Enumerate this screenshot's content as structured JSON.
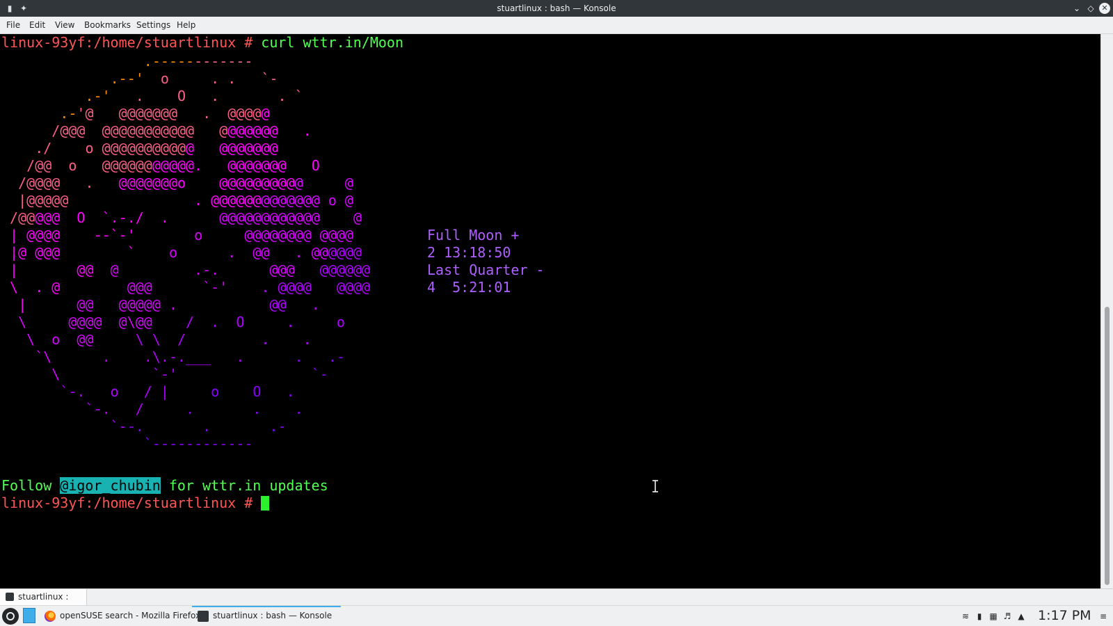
{
  "window": {
    "title": "stuartlinux : bash — Konsole"
  },
  "menubar": {
    "items": [
      "File",
      "Edit",
      "View",
      "Bookmarks",
      "Settings",
      "Help"
    ]
  },
  "terminal": {
    "prompt": "linux-93yf:/home/stuartlinux # ",
    "command": "curl wttr.in/Moon",
    "moon_art": [
      "                 .------------",
      "             .--'  o     . .   `-",
      "          .-'   .    O   .       . `",
      "       .-'@   @@@@@@@   .  @@@@@",
      "      /@@@  @@@@@@@@@@@   @@@@@@@   .",
      "    ./    o @@@@@@@@@@@   @@@@@@@",
      "   /@@  o   @@@@@@@@@@@.   @@@@@@@   O",
      "  /@@@@   .   @@@@@@@o    @@@@@@@@@@     @",
      "  |@@@@@               . @@@@@@@@@@@@@ o @",
      " /@@@@@  O  `.-./  .      @@@@@@@@@@@@    @",
      " | @@@@    --`-'       o     @@@@@@@@ @@@@",
      " |@ @@@        `    o      .  @@   . @@@@@@",
      " |       @@  @         .-.      @@@   @@@@@@",
      " \\  . @        @@@      `-'    . @@@@   @@@@",
      "  |      @@   @@@@@ .           @@   .",
      "  \\     @@@@  @\\@@    /  .  O     .     o",
      "   \\  o  @@     \\ \\  /         .    .",
      "    `\\      .    .\\.-.___   .      .   .-",
      "      \\           `-'                `-",
      "       `-.   o   / |     o    O   .",
      "          `-.   /     .       .    .",
      "             `--.       .       .-",
      "                 `------------"
    ],
    "phase_info": [
      "Full Moon +",
      "2 13:18:50",
      "Last Quarter -",
      "4  5:21:01"
    ],
    "follow_prefix": "Follow ",
    "follow_handle": "@igor_chubin",
    "follow_suffix": " for wttr.in updates",
    "prompt2": "linux-93yf:/home/stuartlinux # "
  },
  "tabbar": {
    "tab_label": "stuartlinux : bash"
  },
  "taskbar": {
    "tasks": [
      {
        "label": "openSUSE search - Mozilla Firefox",
        "icon": "firefox-icon"
      },
      {
        "label": "stuartlinux : bash — Konsole",
        "icon": "konsole-icon"
      }
    ],
    "clock": "1:17 PM"
  },
  "colors": {
    "prompt": "#ff5555",
    "command": "#54ff54",
    "handle_bg": "#18b2b2",
    "art_gradient": [
      "#ff8c00",
      "#ff5f87",
      "#ff00ff",
      "#d700ff",
      "#af00ff",
      "#8700ff",
      "#5f5fff"
    ],
    "phase_info_color": "#af5fff",
    "accent": "#3daee9"
  }
}
